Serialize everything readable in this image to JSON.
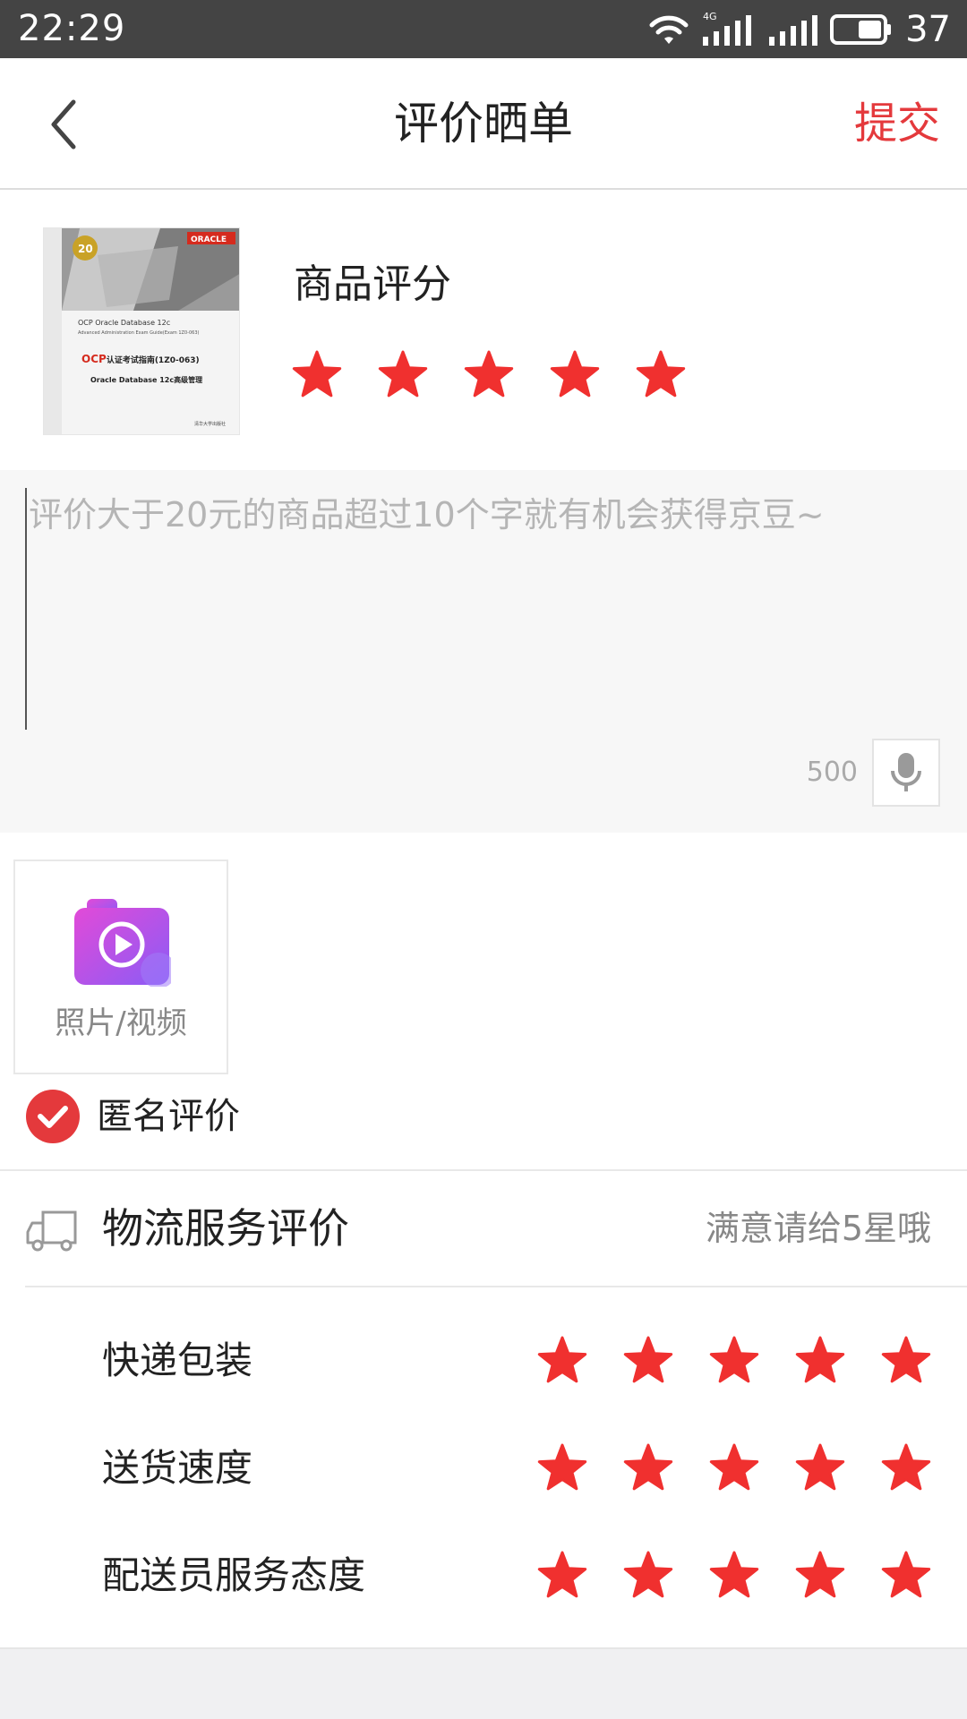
{
  "status_bar": {
    "time": "22:29",
    "network": "4G",
    "battery_level": "37"
  },
  "header": {
    "title": "评价晒单",
    "submit_label": "提交",
    "accent_color": "#e4393c"
  },
  "product": {
    "rating_label": "商品评分",
    "rating_stars": 5,
    "cover": {
      "brand": "ORACLE",
      "edition_badge": "20",
      "line1": "OCP Oracle Database 12c",
      "line2": "Advanced Administration Exam Guide(Exam 1Z0-063)",
      "title_ocp": "OCP",
      "title_rest": "认证考试指南(1Z0-063)",
      "subtitle": "Oracle Database 12c高级管理",
      "publisher": "清华大学出版社"
    }
  },
  "review": {
    "placeholder": "评价大于20元的商品超过10个字就有机会获得京豆~",
    "remaining_chars": "500",
    "mic_icon": "microphone-icon"
  },
  "upload": {
    "label": "照片/视频",
    "icon": "camera-video-icon"
  },
  "anonymous": {
    "label": "匿名评价",
    "checked": true
  },
  "logistics": {
    "title": "物流服务评价",
    "hint": "满意请给5星哦",
    "icon": "truck-icon",
    "items": [
      {
        "label": "快递包装",
        "stars": 5
      },
      {
        "label": "送货速度",
        "stars": 5
      },
      {
        "label": "配送员服务态度",
        "stars": 5
      }
    ]
  },
  "colors": {
    "star": "#f0302f",
    "status_bar": "#444444"
  }
}
